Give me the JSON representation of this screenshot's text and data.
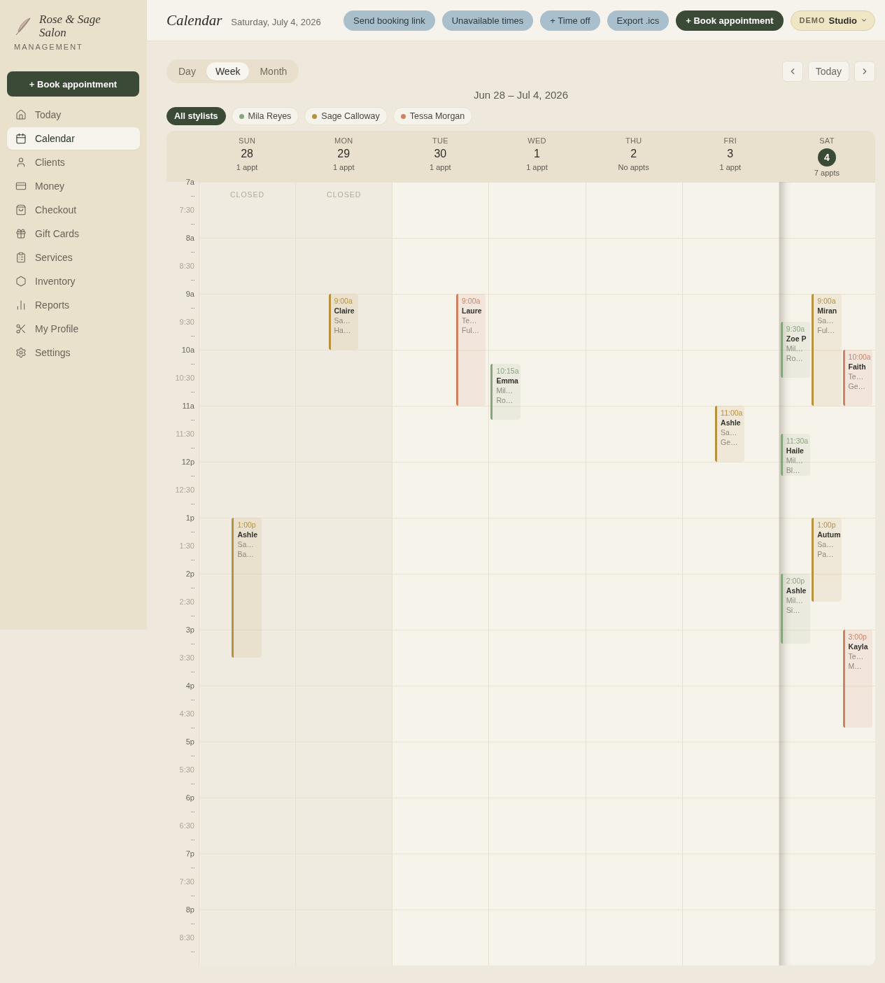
{
  "sidebar": {
    "brand": "Rose & Sage Salon",
    "tagline": "MANAGEMENT",
    "book_button": "+ Book appointment",
    "nav": [
      {
        "label": "Today",
        "selected": false
      },
      {
        "label": "Calendar",
        "selected": true
      },
      {
        "label": "Clients",
        "selected": false
      },
      {
        "label": "Money",
        "selected": false
      },
      {
        "label": "Checkout",
        "selected": false
      },
      {
        "label": "Gift Cards",
        "selected": false
      },
      {
        "label": "Services",
        "selected": false
      },
      {
        "label": "Inventory",
        "selected": false
      },
      {
        "label": "Reports",
        "selected": false
      },
      {
        "label": "My Profile",
        "selected": false
      },
      {
        "label": "Settings",
        "selected": false
      }
    ]
  },
  "header": {
    "title": "Calendar",
    "date": "Saturday, July 4, 2026",
    "actions": [
      {
        "label": "Send booking link",
        "kind": "secondary"
      },
      {
        "label": "Unavailable times",
        "kind": "secondary"
      },
      {
        "label": "+ Time off",
        "kind": "secondary"
      },
      {
        "label": "Export .ics",
        "kind": "secondary"
      },
      {
        "label": "+ Book appointment",
        "kind": "primary"
      }
    ],
    "workspace": {
      "badge": "DEMO",
      "label": "Studio"
    }
  },
  "toolbar": {
    "views": [
      {
        "label": "Day",
        "selected": false
      },
      {
        "label": "Week",
        "selected": true
      },
      {
        "label": "Month",
        "selected": false
      }
    ],
    "today_button": "Today",
    "range": "Jun 28 – Jul 4, 2026"
  },
  "filters": [
    {
      "label": "All stylists",
      "selected": true
    },
    {
      "label": "Mila Reyes",
      "selected": false,
      "color": "#87a67c"
    },
    {
      "label": "Sage Calloway",
      "selected": false,
      "color": "#b8913f"
    },
    {
      "label": "Tessa Morgan",
      "selected": false,
      "color": "#cd8264"
    }
  ],
  "calendar": {
    "times": [
      {
        "label": "7a",
        "kind": "hour"
      },
      {
        "label": "7:30",
        "kind": "half"
      },
      {
        "label": "8a",
        "kind": "hour"
      },
      {
        "label": "8:30",
        "kind": "half"
      },
      {
        "label": "9a",
        "kind": "hour"
      },
      {
        "label": "9:30",
        "kind": "half"
      },
      {
        "label": "10a",
        "kind": "hour"
      },
      {
        "label": "10:30",
        "kind": "half"
      },
      {
        "label": "11a",
        "kind": "hour"
      },
      {
        "label": "11:30",
        "kind": "half"
      },
      {
        "label": "12p",
        "kind": "hour"
      },
      {
        "label": "12:30",
        "kind": "half"
      },
      {
        "label": "1p",
        "kind": "hour"
      },
      {
        "label": "1:30",
        "kind": "half"
      },
      {
        "label": "2p",
        "kind": "hour"
      },
      {
        "label": "2:30",
        "kind": "half"
      },
      {
        "label": "3p",
        "kind": "hour"
      },
      {
        "label": "3:30",
        "kind": "half"
      },
      {
        "label": "4p",
        "kind": "hour"
      },
      {
        "label": "4:30",
        "kind": "half"
      },
      {
        "label": "5p",
        "kind": "hour"
      },
      {
        "label": "5:30",
        "kind": "half"
      },
      {
        "label": "6p",
        "kind": "hour"
      },
      {
        "label": "6:30",
        "kind": "half"
      },
      {
        "label": "7p",
        "kind": "hour"
      },
      {
        "label": "7:30",
        "kind": "half"
      },
      {
        "label": "8p",
        "kind": "hour"
      },
      {
        "label": "8:30",
        "kind": "half"
      }
    ],
    "days": [
      {
        "weekday": "SUN",
        "date": "28",
        "count": "1 appt",
        "today": false,
        "closed": true,
        "closed_label": "CLOSED",
        "appointments": [
          {
            "time": "1:00p",
            "client": "Ashle",
            "stylist": "Sa…",
            "service": "Ba…",
            "color": "#b8913f",
            "kind": "tenquarters"
          }
        ]
      },
      {
        "weekday": "MON",
        "date": "29",
        "count": "1 appt",
        "today": false,
        "closed": true,
        "closed_label": "CLOSED",
        "appointments": [
          {
            "time": "9:00a",
            "client": "Claire",
            "stylist": "Sa…",
            "service": "Ha…",
            "color": "#b8913f",
            "kind": "fourquarters"
          }
        ]
      },
      {
        "weekday": "TUE",
        "date": "30",
        "count": "1 appt",
        "today": false,
        "closed": false,
        "appointments": [
          {
            "time": "9:00a",
            "client": "Laure",
            "stylist": "Te…",
            "service": "Ful…",
            "color": "#cd8264",
            "kind": "eightquarters"
          }
        ]
      },
      {
        "weekday": "WED",
        "date": "1",
        "count": "1 appt",
        "today": false,
        "closed": false,
        "appointments": [
          {
            "time": "10:15a",
            "client": "Emma",
            "stylist": "Mil…",
            "service": "Ro…",
            "color": "#87a67c",
            "kind": "fourquarters"
          }
        ]
      },
      {
        "weekday": "THU",
        "date": "2",
        "count": "No appts",
        "today": false,
        "closed": false
      },
      {
        "weekday": "FRI",
        "date": "3",
        "count": "1 appt",
        "today": false,
        "closed": false,
        "appointments": [
          {
            "time": "11:00a",
            "client": "Ashle",
            "stylist": "Sa…",
            "service": "Ge…",
            "color": "#b8913f",
            "kind": "fourquarters"
          }
        ]
      },
      {
        "weekday": "SAT",
        "date": "4",
        "count": "7 appts",
        "today": true,
        "closed": false,
        "appointments": [
          {
            "time": "9:00a",
            "client": "Miran",
            "stylist": "Sa…",
            "service": "Ful…",
            "color": "#b8913f",
            "kind": "eightquarters"
          },
          {
            "time": "9:30a",
            "client": "Zoe P",
            "stylist": "Mil…",
            "service": "Ro…",
            "color": "#87a67c",
            "kind": "fourquarters"
          },
          {
            "time": "10:00a",
            "client": "Faith",
            "stylist": "Te…",
            "service": "Ge…",
            "color": "#cd8264",
            "kind": "fourquarters"
          },
          {
            "time": "11:30a",
            "client": "Haile",
            "stylist": "Mil…",
            "service": "Bl…",
            "color": "#87a67c",
            "kind": "threequarters"
          },
          {
            "time": "1:00p",
            "client": "Autum",
            "stylist": "Sa…",
            "service": "Pa…",
            "color": "#b8913f",
            "kind": "sixquarters"
          },
          {
            "time": "2:00p",
            "client": "Ashle",
            "stylist": "Mil…",
            "service": "Si…",
            "color": "#87a67c",
            "kind": "fivequarters"
          },
          {
            "time": "3:00p",
            "client": "Kayla",
            "stylist": "Te…",
            "service": "M…",
            "color": "#cd8264",
            "kind": "sevenquarters"
          }
        ]
      }
    ]
  }
}
